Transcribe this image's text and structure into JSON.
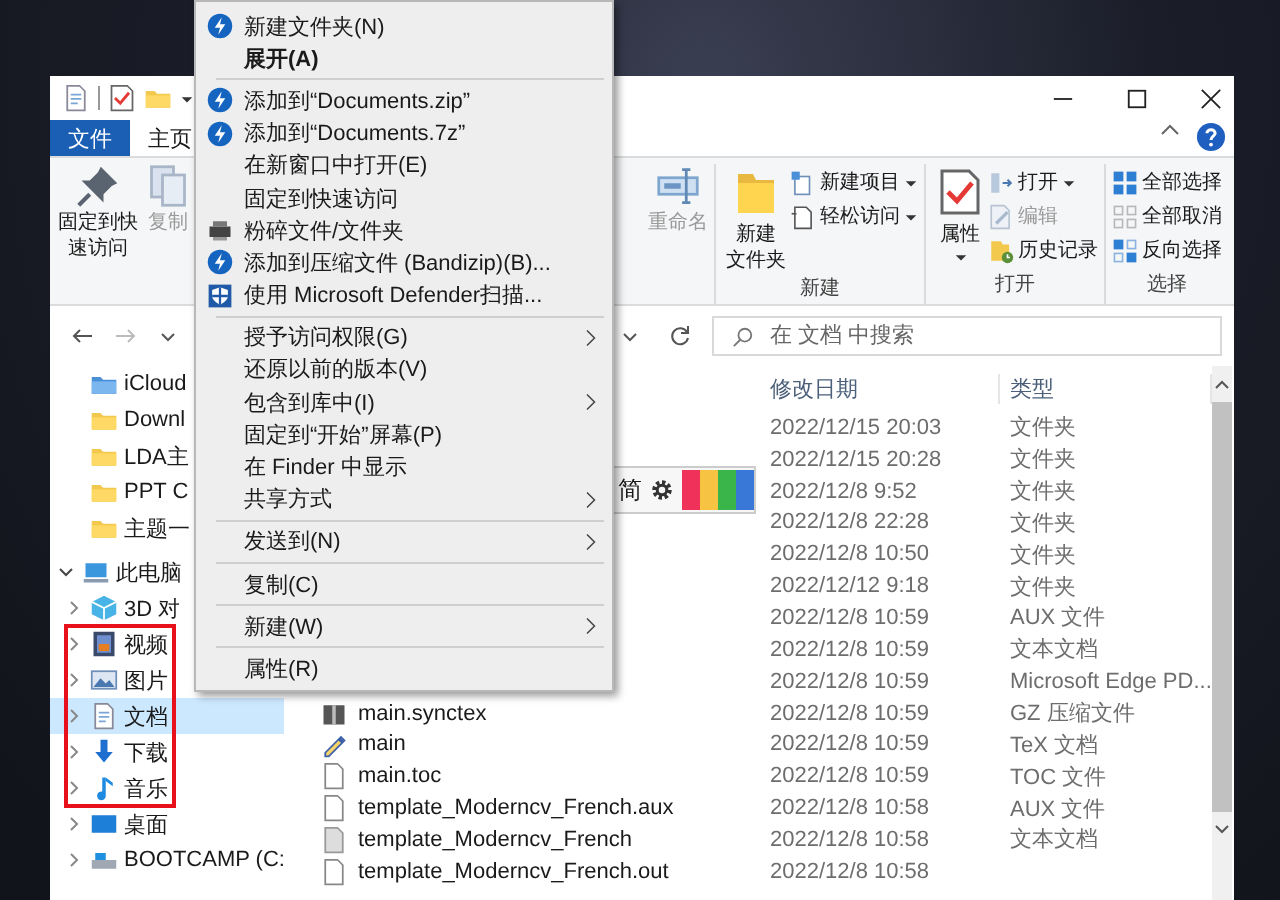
{
  "ribbon": {
    "tabs": [
      {
        "label": "文件",
        "selected": true
      },
      {
        "label": "主页",
        "selected": false
      }
    ],
    "pin_button": {
      "label_lines": [
        "固定到快",
        "速访问"
      ],
      "disabled": false
    },
    "copy_button": {
      "label_lines": [
        "复制"
      ],
      "disabled": true
    },
    "rename_button": {
      "label_lines": [
        "重命名"
      ],
      "disabled": true
    },
    "groups": [
      {
        "label": "新建",
        "large": {
          "label_lines": [
            "新建",
            "文件夹"
          ],
          "dropdown": false
        },
        "small": [
          {
            "label": "新建项目",
            "dropdown": true,
            "disabled": false
          },
          {
            "label": "轻松访问",
            "dropdown": true,
            "disabled": false
          }
        ]
      },
      {
        "label": "打开",
        "large": {
          "label_lines": [
            "属性"
          ],
          "dropdown": true
        },
        "small": [
          {
            "label": "打开",
            "dropdown": true,
            "disabled": false
          },
          {
            "label": "编辑",
            "dropdown": false,
            "disabled": true
          },
          {
            "label": "历史记录",
            "dropdown": false,
            "disabled": false
          }
        ]
      },
      {
        "label": "选择",
        "small": [
          {
            "label": "全部选择",
            "dropdown": false,
            "disabled": false
          },
          {
            "label": "全部取消",
            "dropdown": false,
            "disabled": false
          },
          {
            "label": "反向选择",
            "dropdown": false,
            "disabled": false
          }
        ]
      }
    ]
  },
  "address_bar": {
    "search": {
      "placeholder": "在 文档 中搜索"
    }
  },
  "nav": {
    "pinned": [
      {
        "label": "iCloud",
        "selected": false
      },
      {
        "label": "Downl",
        "selected": false
      },
      {
        "label": "LDA主",
        "selected": false
      },
      {
        "label": "PPT C",
        "selected": false
      },
      {
        "label": "主题一",
        "selected": false
      }
    ],
    "this_pc": {
      "label": "此电脑",
      "expanded": true,
      "children": [
        {
          "label": "3D 对",
          "expanded": false,
          "selected": false,
          "highlighted": false
        },
        {
          "label": "视频",
          "expanded": false,
          "selected": false,
          "highlighted": true
        },
        {
          "label": "图片",
          "expanded": false,
          "selected": false,
          "highlighted": true
        },
        {
          "label": "文档",
          "expanded": false,
          "selected": true,
          "highlighted": true
        },
        {
          "label": "下载",
          "expanded": false,
          "selected": false,
          "highlighted": true
        },
        {
          "label": "音乐",
          "expanded": false,
          "selected": false,
          "highlighted": true
        },
        {
          "label": "桌面",
          "expanded": false,
          "selected": false,
          "highlighted": false
        },
        {
          "label": "BOOTCAMP (C:",
          "expanded": false,
          "selected": false,
          "highlighted": false
        }
      ]
    }
  },
  "file_list": {
    "columns": [
      "修改日期",
      "类型"
    ],
    "rows": [
      {
        "date": "2022/12/15 20:03",
        "type": "文件夹"
      },
      {
        "date": "2022/12/15 20:28",
        "type": "文件夹"
      },
      {
        "date": "2022/12/8 9:52",
        "type": "文件夹"
      },
      {
        "date": "2022/12/8 22:28",
        "type": "文件夹"
      },
      {
        "date": "2022/12/8 10:50",
        "type": "文件夹"
      },
      {
        "date": "2022/12/12 9:18",
        "type": "文件夹"
      },
      {
        "date": "2022/12/8 10:59",
        "type": "AUX 文件"
      },
      {
        "date": "2022/12/8 10:59",
        "type": "文本文档"
      },
      {
        "date": "2022/12/8 10:59",
        "type": "Microsoft Edge PD..."
      },
      {
        "kind": "gz",
        "name": "main.synctex",
        "date": "2022/12/8 10:59",
        "type": "GZ 压缩文件"
      },
      {
        "kind": "tex",
        "name": "main",
        "date": "2022/12/8 10:59",
        "type": "TeX 文档"
      },
      {
        "kind": "toc",
        "name": "main.toc",
        "date": "2022/12/8 10:59",
        "type": "TOC 文件"
      },
      {
        "kind": "aux",
        "name": "template_Moderncv_French.aux",
        "date": "2022/12/8 10:58",
        "type": "AUX 文件"
      },
      {
        "kind": "text",
        "name": "template_Moderncv_French",
        "date": "2022/12/8 10:58",
        "type": "文本文档"
      },
      {
        "kind": "file",
        "name": "template_Moderncv_French.out",
        "date": "2022/12/8 10:58"
      }
    ]
  },
  "ime_toolbar": {
    "label": "简"
  },
  "context_menu": {
    "items": [
      {
        "kind": "item",
        "label": "新建文件夹(N)",
        "default": false,
        "submenu": false
      },
      {
        "kind": "item",
        "label": "展开(A)",
        "default": true,
        "submenu": false
      },
      {
        "kind": "separator"
      },
      {
        "kind": "item",
        "label": "添加到“Documents.zip”",
        "default": false,
        "submenu": false
      },
      {
        "kind": "item",
        "label": "添加到“Documents.7z”",
        "default": false,
        "submenu": false
      },
      {
        "kind": "item",
        "label": "在新窗口中打开(E)",
        "default": false,
        "submenu": false
      },
      {
        "kind": "item",
        "label": "固定到快速访问",
        "default": false,
        "submenu": false
      },
      {
        "kind": "item",
        "label": "粉碎文件/文件夹",
        "default": false,
        "submenu": false
      },
      {
        "kind": "item",
        "label": "添加到压缩文件 (Bandizip)(B)...",
        "default": false,
        "submenu": false
      },
      {
        "kind": "item",
        "label": "使用 Microsoft Defender扫描...",
        "default": false,
        "submenu": false
      },
      {
        "kind": "separator"
      },
      {
        "kind": "item",
        "label": "授予访问权限(G)",
        "default": false,
        "submenu": true
      },
      {
        "kind": "item",
        "label": "还原以前的版本(V)",
        "default": false,
        "submenu": false
      },
      {
        "kind": "item",
        "label": "包含到库中(I)",
        "default": false,
        "submenu": true
      },
      {
        "kind": "item",
        "label": "固定到“开始”屏幕(P)",
        "default": false,
        "submenu": false
      },
      {
        "kind": "item",
        "label": "在 Finder 中显示",
        "default": false,
        "submenu": false
      },
      {
        "kind": "item",
        "label": "共享方式",
        "default": false,
        "submenu": true
      },
      {
        "kind": "separator"
      },
      {
        "kind": "item",
        "label": "发送到(N)",
        "default": false,
        "submenu": true
      },
      {
        "kind": "separator"
      },
      {
        "kind": "item",
        "label": "复制(C)",
        "default": false,
        "submenu": false
      },
      {
        "kind": "separator"
      },
      {
        "kind": "item",
        "label": "新建(W)",
        "default": false,
        "submenu": true
      },
      {
        "kind": "separator"
      },
      {
        "kind": "item",
        "label": "属性(R)",
        "default": false,
        "submenu": false
      }
    ]
  }
}
